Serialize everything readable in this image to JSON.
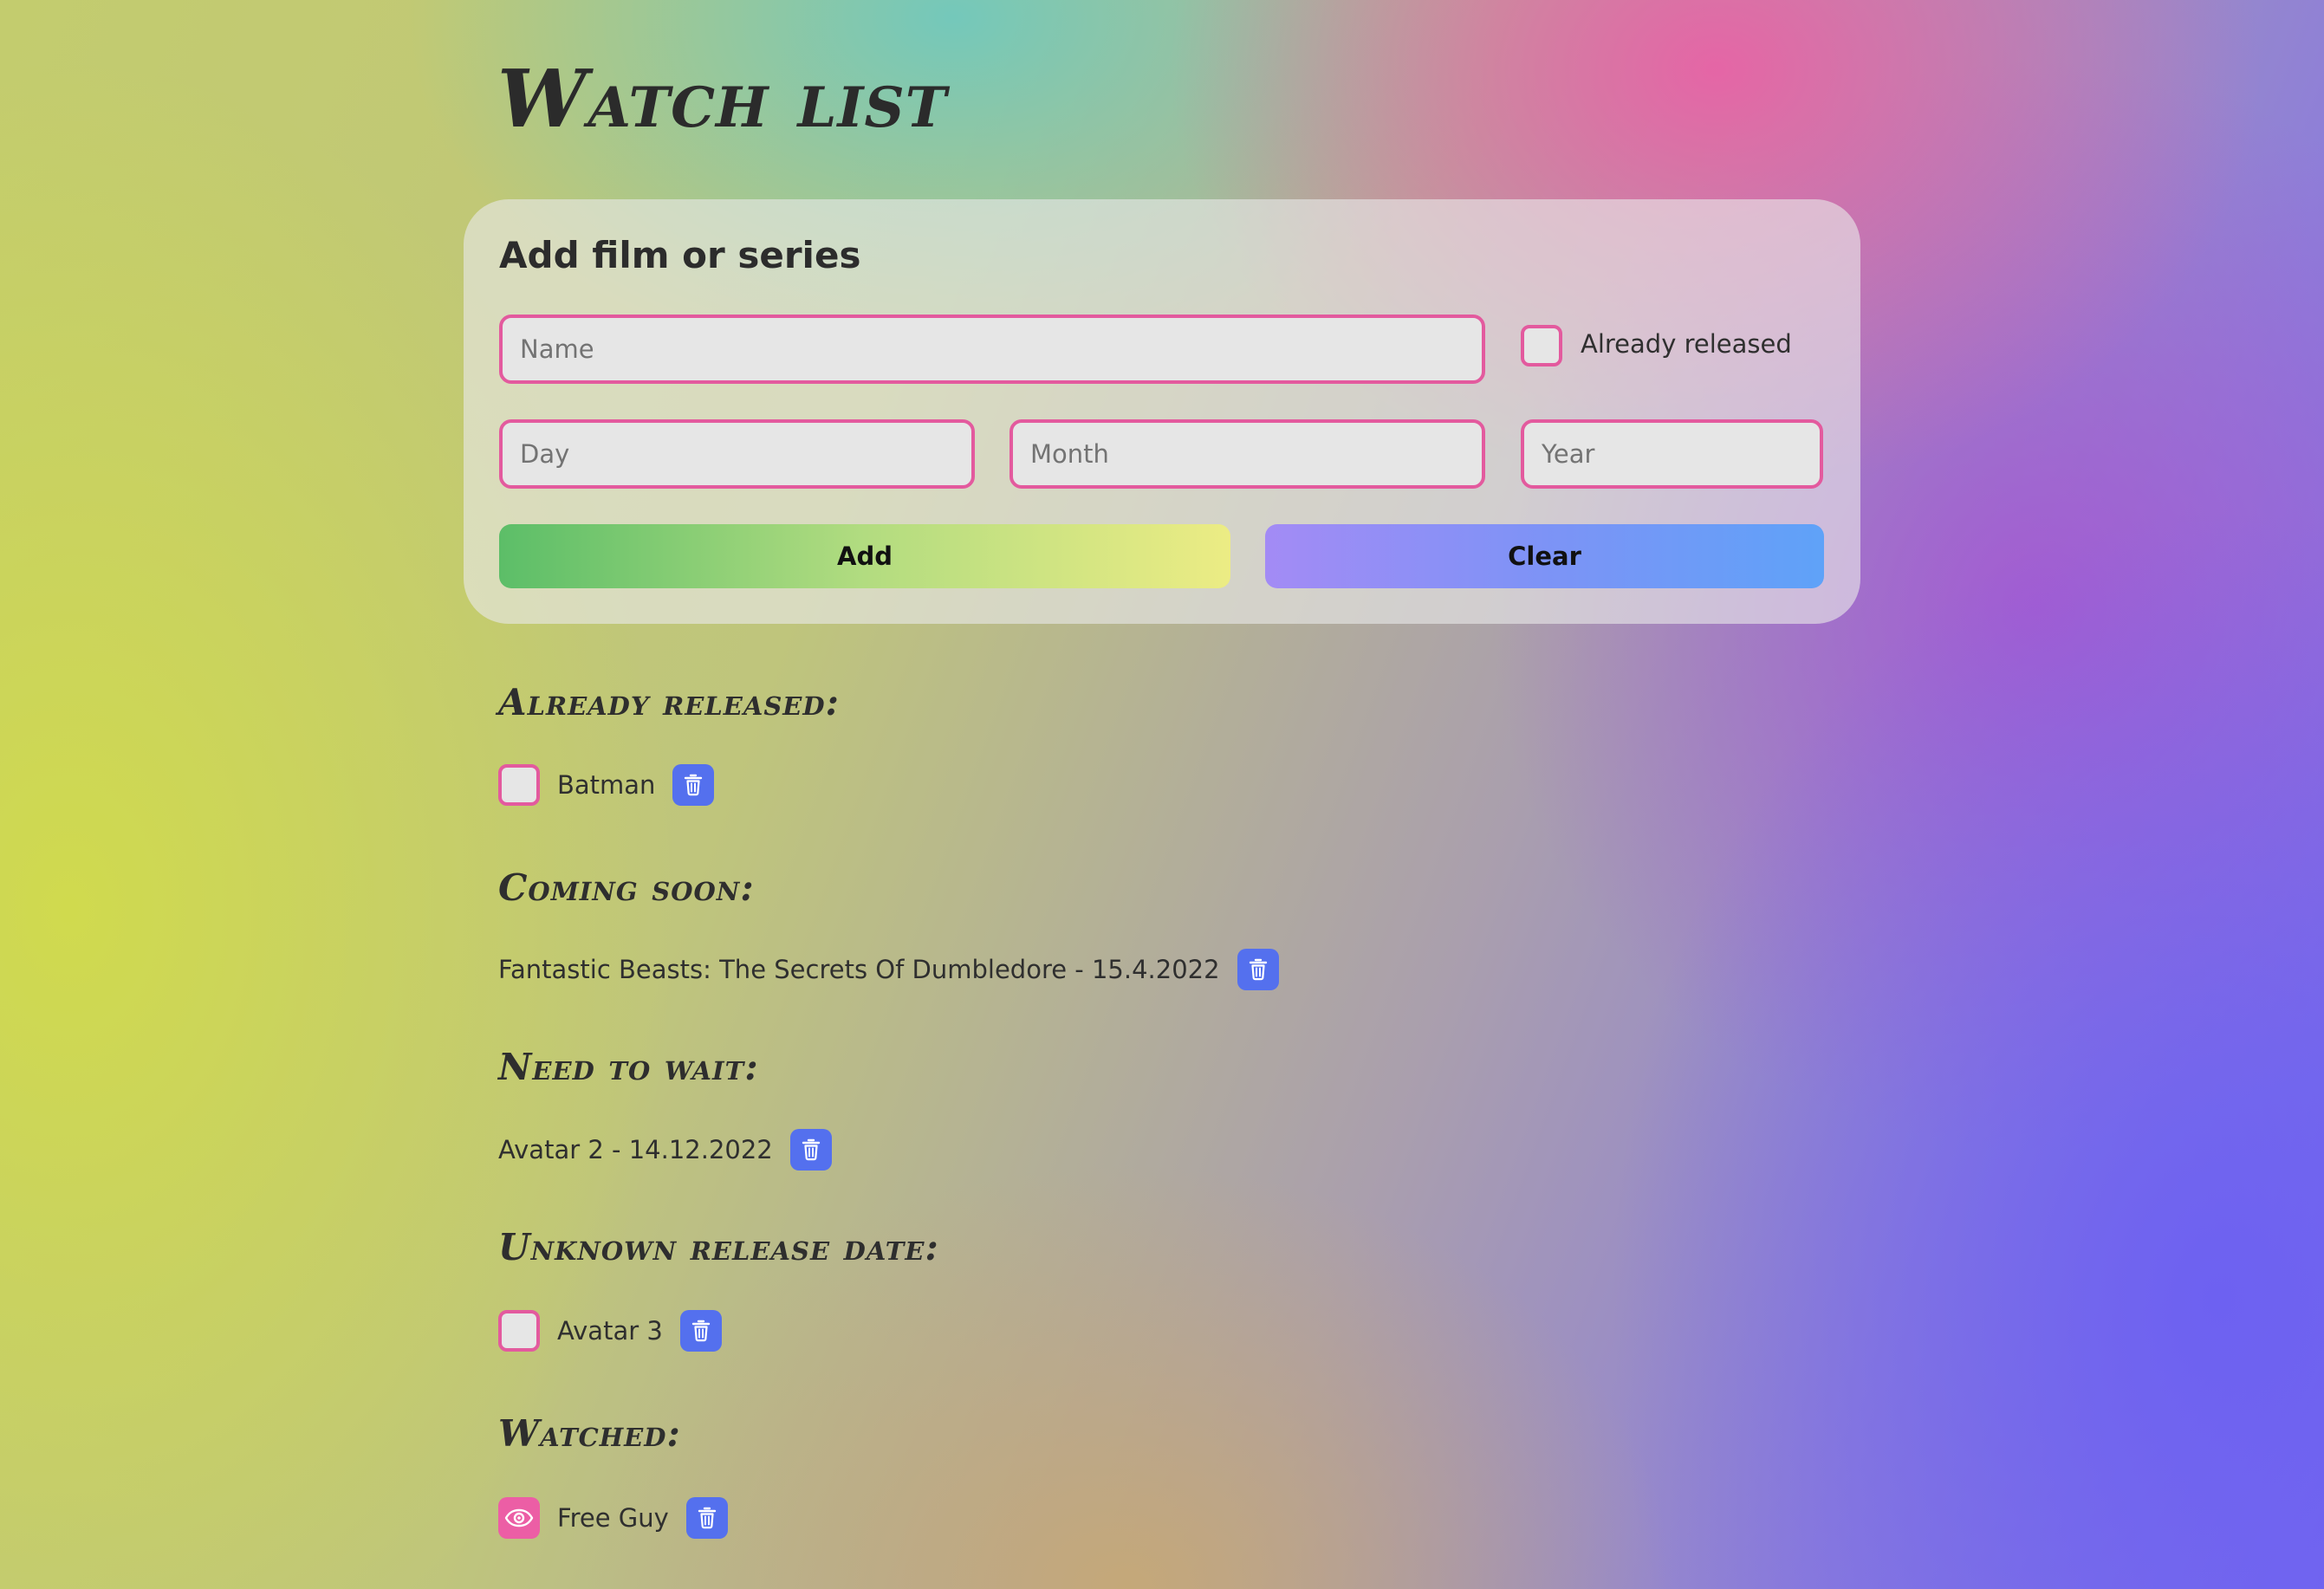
{
  "page": {
    "title": "Watch list"
  },
  "form": {
    "title": "Add film or series",
    "name_placeholder": "Name",
    "already_released_label": "Already released",
    "day_placeholder": "Day",
    "month_placeholder": "Month",
    "year_placeholder": "Year",
    "add_label": "Add",
    "clear_label": "Clear"
  },
  "sections": {
    "already_released": {
      "title": "Already released:",
      "items": [
        {
          "label": "Batman",
          "watched": false
        }
      ]
    },
    "coming_soon": {
      "title": "Coming soon:",
      "items": [
        {
          "label": "Fantastic Beasts: The Secrets Of Dumbledore - 15.4.2022"
        }
      ]
    },
    "need_to_wait": {
      "title": "Need to wait:",
      "items": [
        {
          "label": "Avatar 2 - 14.12.2022"
        }
      ]
    },
    "unknown_release_date": {
      "title": "Unknown release date:",
      "items": [
        {
          "label": "Avatar 3",
          "watched": false
        }
      ]
    },
    "watched": {
      "title": "Watched:",
      "items": [
        {
          "label": "Free Guy",
          "watched": true
        }
      ]
    }
  },
  "icons": {
    "delete": "trash-icon",
    "watched": "eye-icon"
  },
  "colors": {
    "accent_border": "#e35a9e",
    "delete_button": "#5470ee",
    "watched_check": "#ec5ea5"
  }
}
